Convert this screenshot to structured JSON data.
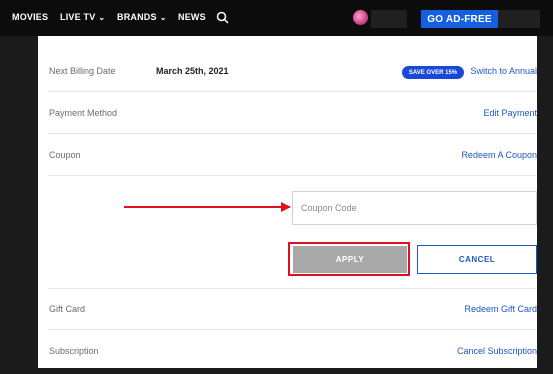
{
  "nav": {
    "items": [
      {
        "label": "MOVIES",
        "chevron": false
      },
      {
        "label": "LIVE TV",
        "chevron": true
      },
      {
        "label": "BRANDS",
        "chevron": true
      },
      {
        "label": "NEWS",
        "chevron": false
      }
    ],
    "chevron_glyph": "⌄",
    "search_icon": "search-icon",
    "ad_free_label": "GO AD-FREE"
  },
  "account": {
    "billing": {
      "label": "Next Billing Date",
      "value": "March 25th, 2021",
      "badge": "SAVE OVER 15%",
      "link": "Switch to Annual"
    },
    "payment": {
      "label": "Payment Method",
      "link": "Edit Payment"
    },
    "coupon": {
      "label": "Coupon",
      "link": "Redeem A Coupon",
      "input_value": "",
      "input_placeholder": "Coupon Code",
      "apply_label": "APPLY",
      "cancel_label": "CANCEL"
    },
    "gift": {
      "label": "Gift Card",
      "link": "Redeem Gift Card"
    },
    "subscription": {
      "label": "Subscription",
      "link": "Cancel Subscription"
    }
  },
  "colors": {
    "accent": "#1f57c6",
    "ad_free_bg": "#1460e0",
    "annotation_red": "#e01020",
    "apply_disabled": "#a9a9a9"
  }
}
